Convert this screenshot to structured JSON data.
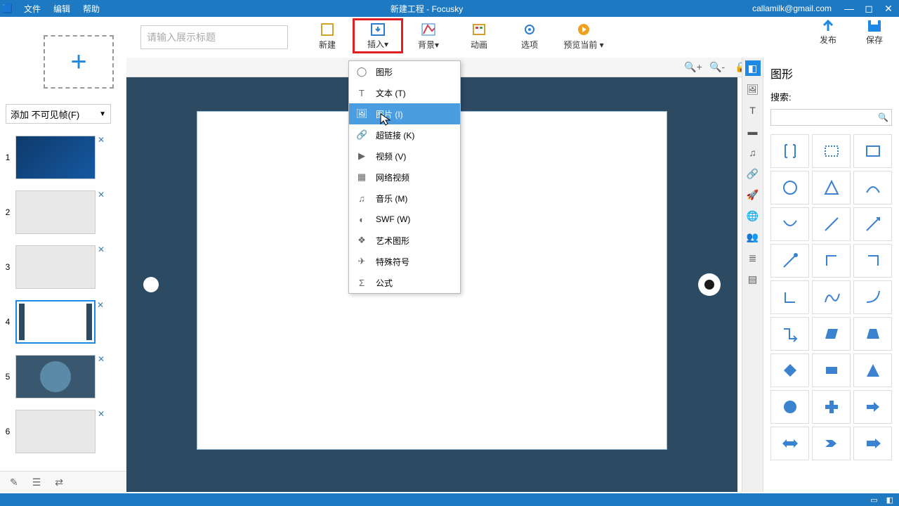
{
  "title_bar": {
    "menu": [
      "文件",
      "编辑",
      "帮助"
    ],
    "title": "新建工程 - Focusky",
    "user_email": "callamilk@gmail.com"
  },
  "add_frame_label": "添加 不可见帧(F)",
  "title_placeholder": "请输入展示标题",
  "main_tools": {
    "new": "新建",
    "insert": "插入",
    "background": "背景",
    "animation": "动画",
    "options": "选项",
    "preview": "预览当前"
  },
  "right_tools": {
    "publish": "发布",
    "save": "保存"
  },
  "dropdown": [
    {
      "label": "图形",
      "icon": "shape"
    },
    {
      "label": "文本 (T)",
      "icon": "T"
    },
    {
      "label": "图片 (I)",
      "icon": "image"
    },
    {
      "label": "超链接 (K)",
      "icon": "link"
    },
    {
      "label": "视频 (V)",
      "icon": "video"
    },
    {
      "label": "网络视频",
      "icon": "web"
    },
    {
      "label": "音乐 (M)",
      "icon": "music"
    },
    {
      "label": "SWF (W)",
      "icon": "swf"
    },
    {
      "label": "艺术图形",
      "icon": "art"
    },
    {
      "label": "特殊符号",
      "icon": "symbol"
    },
    {
      "label": "公式",
      "icon": "formula"
    }
  ],
  "thumbs": [
    1,
    2,
    3,
    4,
    5,
    6
  ],
  "selected_thumb": 4,
  "shapes_panel": {
    "title": "图形",
    "search_label": "搜索:"
  }
}
